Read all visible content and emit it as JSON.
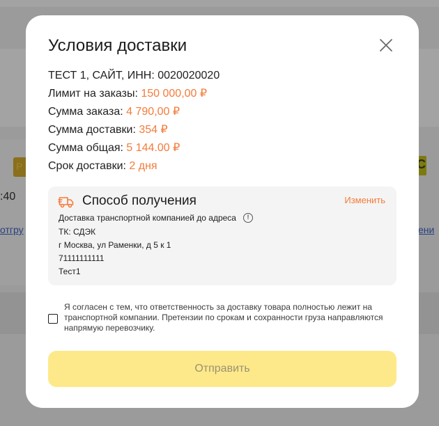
{
  "background": {
    "left_badge": "Р",
    "right_badge": "С",
    "left_text": ":40",
    "left_link": "отгру",
    "right_link": "ени"
  },
  "modal": {
    "title": "Условия доставки",
    "close_icon": "close-icon",
    "info": [
      {
        "label": "ТЕСТ 1, САЙТ, ИНН: 0020020020",
        "value": ""
      },
      {
        "label": "Лимит на заказы: ",
        "value": "150 000,00 ₽"
      },
      {
        "label": "Сумма заказа: ",
        "value": "4 790,00 ₽"
      },
      {
        "label": "Сумма доставки: ",
        "value": "354 ₽"
      },
      {
        "label": "Сумма общая: ",
        "value": "5 144.00 ₽"
      },
      {
        "label": "Срок доставки: ",
        "value": "2 дня"
      }
    ],
    "delivery": {
      "icon": "truck-icon",
      "title": "Способ получения",
      "change_label": "Изменить",
      "method": "Доставка транспортной компанией до адреса",
      "info_icon": "info-circle-icon",
      "carrier": "ТК: СДЭК",
      "address": "г Москва, ул Раменки, д 5 к 1",
      "phone": "71111111111",
      "recipient": "Тест1"
    },
    "consent_text": "Я согласен с тем, что ответственность за доставку товара полностью лежит на транспортной компании. Претензии по срокам и сохранности груза направляются напрямую перевозчику.",
    "consent_checked": false,
    "submit_label": "Отправить"
  },
  "colors": {
    "accent": "#f47b3a",
    "button": "#fde98a",
    "button_text": "#9b9272"
  }
}
